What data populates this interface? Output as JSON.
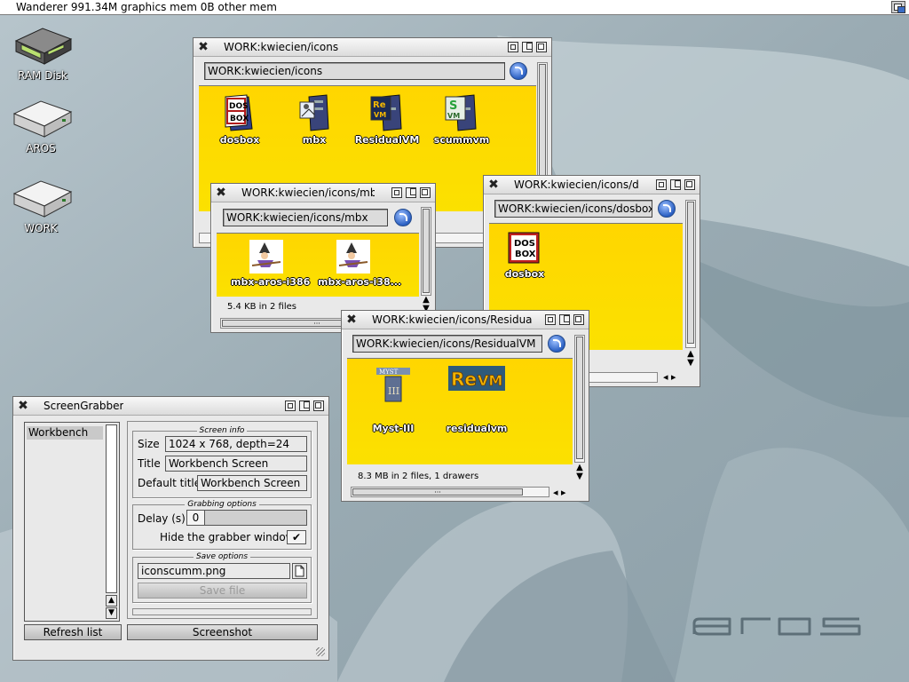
{
  "screen": {
    "title": "Wanderer 991.34M graphics mem 0B other mem"
  },
  "desktop_icons": [
    {
      "label": "RAM Disk",
      "icon": "ram-disk-icon"
    },
    {
      "label": "AROS",
      "icon": "hard-drive-icon"
    },
    {
      "label": "WORK",
      "icon": "hard-drive-icon"
    }
  ],
  "windows": {
    "icons": {
      "title": "WORK:kwiecien/icons",
      "path": "WORK:kwiecien/icons",
      "items": [
        {
          "label": "dosbox",
          "icon": "dosbox-icon"
        },
        {
          "label": "mbx",
          "icon": "mbx-icon"
        },
        {
          "label": "ResidualVM",
          "icon": "residualvm-icon"
        },
        {
          "label": "scummvm",
          "icon": "scummvm-icon"
        }
      ]
    },
    "mb": {
      "title": "WORK:kwiecien/icons/mb",
      "path": "WORK:kwiecien/icons/mbx",
      "items": [
        {
          "label": "mbx-aros-i386",
          "icon": "witch-icon"
        },
        {
          "label": "mbx-aros-i38...",
          "icon": "witch-icon"
        }
      ],
      "status": "5.4 KB in 2 files"
    },
    "d": {
      "title": "WORK:kwiecien/icons/d",
      "path": "WORK:kwiecien/icons/dosbox",
      "items": [
        {
          "label": "dosbox",
          "icon": "dosbox-icon"
        }
      ]
    },
    "residua": {
      "title": "WORK:kwiecien/icons/Residua",
      "path": "WORK:kwiecien/icons/ResidualVM",
      "items": [
        {
          "label": "Myst-III",
          "icon": "myst-icon"
        },
        {
          "label": "residualvm",
          "icon": "revm-icon"
        }
      ],
      "status": "8.3 MB in 2 files, 1 drawers"
    }
  },
  "screengrabber": {
    "title": "ScreenGrabber",
    "screen_list": [
      "Workbench"
    ],
    "screen_info": {
      "heading": "Screen info",
      "size_label": "Size",
      "size_value": "1024 x 768, depth=24",
      "title_label": "Title",
      "title_value": "Workbench Screen",
      "default_title_label": "Default title",
      "default_title_value": "Workbench Screen"
    },
    "grabbing": {
      "heading": "Grabbing options",
      "delay_label": "Delay (s)",
      "delay_value": "0",
      "hide_label": "Hide the grabber window",
      "hide_checked": "✔"
    },
    "save": {
      "heading": "Save options",
      "filename": "iconscumm.png",
      "save_label": "Save file"
    },
    "refresh_label": "Refresh list",
    "screenshot_label": "Screenshot"
  },
  "logo_text": "aros",
  "colors": {
    "drawer_bg": "#ffd600",
    "desktop_bg": "#9fb0b8",
    "accent_blue": "#2a5fc2"
  }
}
